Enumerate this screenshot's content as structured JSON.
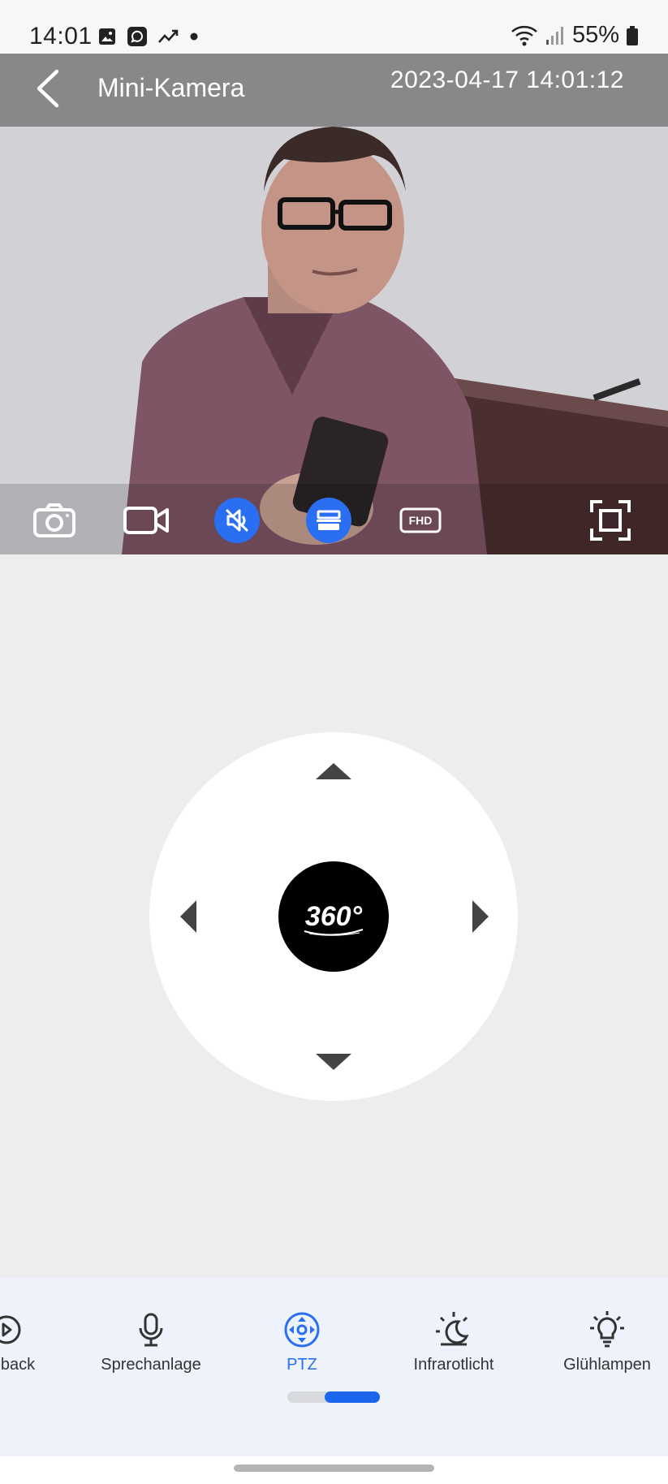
{
  "status_bar": {
    "time": "14:01",
    "battery": "55%",
    "icons": [
      "gallery-icon",
      "messenger-icon",
      "trend-icon",
      "dot-icon",
      "wifi-icon",
      "signal-icon",
      "battery-icon"
    ]
  },
  "video": {
    "title": "Mini-Kamera",
    "timestamp": "2023-04-17 14:01:12",
    "toolbar": {
      "snapshot_icon": "camera-icon",
      "record_icon": "video-record-icon",
      "mute_icon": "speaker-muted-icon",
      "view_icon": "screen-split-icon",
      "quality_label": "FHD",
      "fullscreen_icon": "fullscreen-icon"
    }
  },
  "ptz": {
    "center_label": "360°",
    "arrows": [
      "up-arrow-icon",
      "left-arrow-icon",
      "right-arrow-icon",
      "down-arrow-icon"
    ]
  },
  "bottom_nav": {
    "items": [
      {
        "label": "back",
        "icon": "playback-icon"
      },
      {
        "label": "Sprechanlage",
        "icon": "microphone-icon"
      },
      {
        "label": "PTZ",
        "icon": "ptz-icon"
      },
      {
        "label": "Infrarotlicht",
        "icon": "night-mode-icon"
      },
      {
        "label": "Glühlampen",
        "icon": "lightbulb-icon"
      }
    ],
    "active_index": 2,
    "pager_position": 0.5
  },
  "colors": {
    "accent": "#2a6ff2",
    "page_bg": "#ededed",
    "panel_bg": "#eef2fb"
  }
}
